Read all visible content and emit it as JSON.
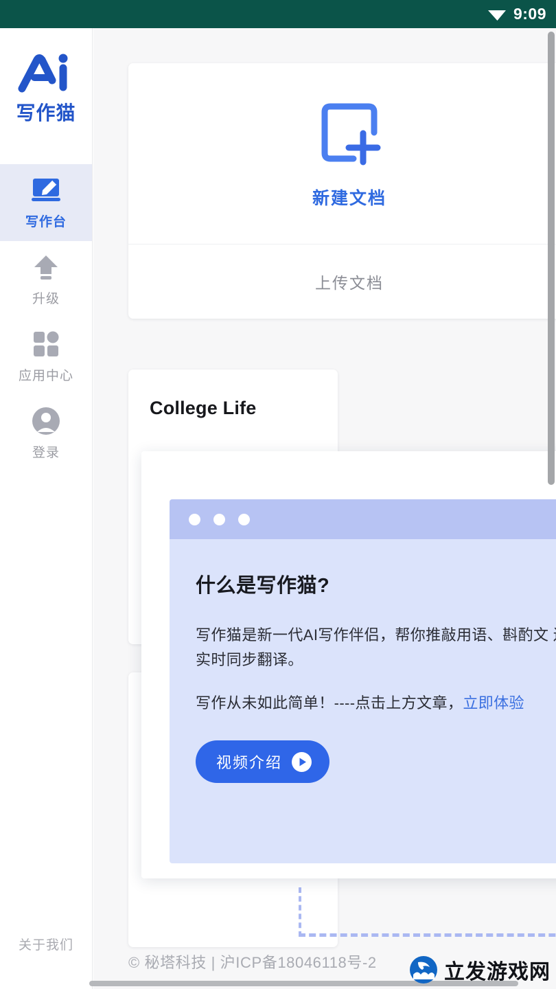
{
  "status_bar": {
    "time": "9:09",
    "wifi_icon": "wifi-icon",
    "background": "#0b5449"
  },
  "sidebar": {
    "logo": {
      "mark": "ai-logo-icon",
      "text": "写作猫",
      "color": "#2355c9"
    },
    "items": [
      {
        "icon": "writing-desk-icon",
        "label": "写作台",
        "active": true
      },
      {
        "icon": "upgrade-arrow-icon",
        "label": "升级",
        "active": false
      },
      {
        "icon": "app-center-grid-icon",
        "label": "应用中心",
        "active": false
      },
      {
        "icon": "user-account-icon",
        "label": "登录",
        "active": false
      }
    ],
    "about_label": "关于我们",
    "active_bg": "#e7eaf6",
    "active_color": "#2f6ae0"
  },
  "main": {
    "new_document": {
      "icon": "new-document-plus-icon",
      "label": "新建文档",
      "upload_label": "上传文档",
      "accent": "#2f6ae0"
    },
    "documents": [
      {
        "title": "College Life"
      }
    ]
  },
  "modal": {
    "window_dots": 3,
    "heading": "什么是写作猫?",
    "paragraph": "写作猫是新一代AI写作伴侣，帮你推敲用语、斟酌文\n还能实时同步翻译。",
    "cta_prefix": "写作从未如此简单！----点击上方文章，",
    "cta_link": "立即体验",
    "video_button": "视频介绍",
    "play_icon": "play-circle-icon",
    "header_color": "#b7c3f3",
    "body_color": "#dbe3fb",
    "button_color": "#2f66e8"
  },
  "footer": {
    "copyright": "© 秘塔科技 | 沪ICP备18046118号-2"
  },
  "watermark": {
    "icon": "dolphin-logo-icon",
    "text": "立发游戏网"
  },
  "scrollbars": {
    "vertical": "vertical-scrollbar",
    "horizontal": "horizontal-scrollbar"
  }
}
